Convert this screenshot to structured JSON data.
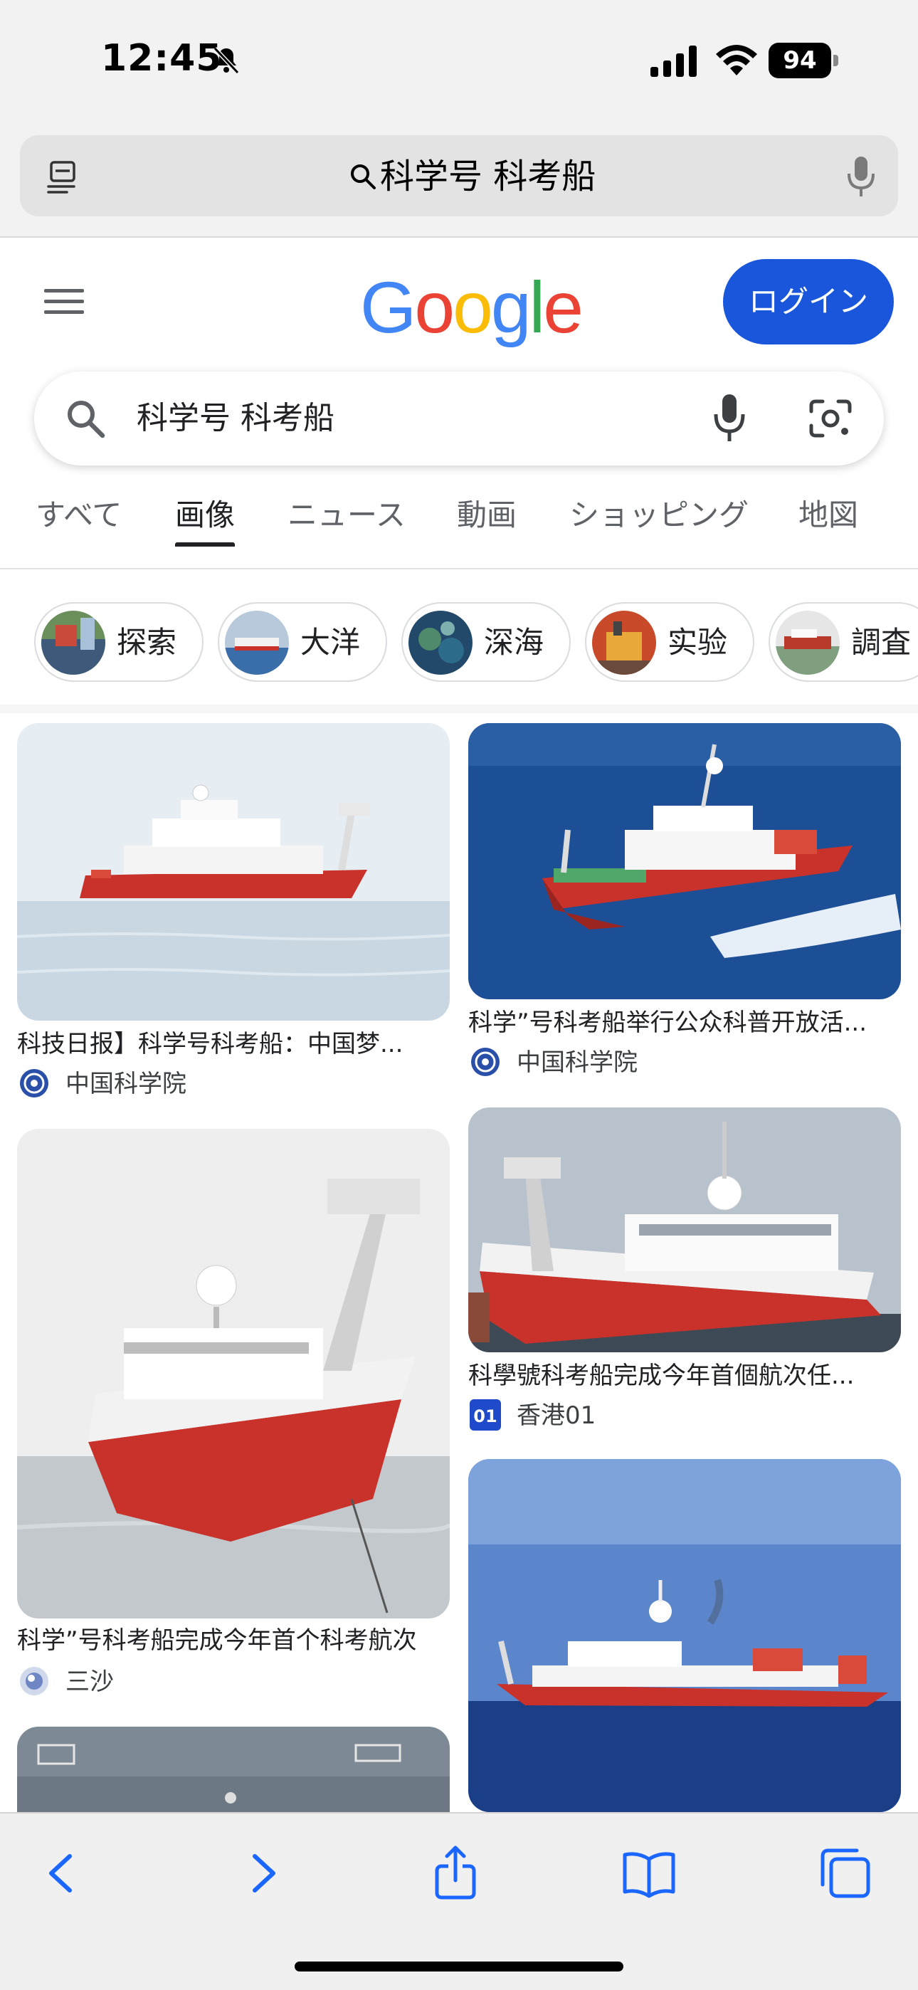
{
  "status_bar": {
    "time": "12:45",
    "battery": "94"
  },
  "address_bar": {
    "query": "科学号 科考船"
  },
  "header": {
    "logo_letters": [
      "G",
      "o",
      "o",
      "g",
      "l",
      "e"
    ],
    "logo_colors": [
      "#4285F4",
      "#EA4335",
      "#FBBC05",
      "#4285F4",
      "#34A853",
      "#EA4335"
    ],
    "login_label": "ログイン"
  },
  "search": {
    "query": "科学号 科考船"
  },
  "tabs": [
    {
      "label": "すべて",
      "active": false
    },
    {
      "label": "画像",
      "active": true
    },
    {
      "label": "ニュース",
      "active": false
    },
    {
      "label": "動画",
      "active": false
    },
    {
      "label": "ショッピング",
      "active": false
    },
    {
      "label": "地図",
      "active": false
    }
  ],
  "chips": [
    {
      "label": "探索"
    },
    {
      "label": "大洋"
    },
    {
      "label": "深海"
    },
    {
      "label": "实验"
    },
    {
      "label": "調査"
    }
  ],
  "results": [
    {
      "title": "科技日报】科学号科考船：中国梦...",
      "source": "中国科学院"
    },
    {
      "title": "科学”号科考船举行公众科普开放活...",
      "source": "中国科学院"
    },
    {
      "title": "科学”号科考船完成今年首个科考航次",
      "source": "三沙"
    },
    {
      "title": "科學號科考船完成今年首個航次任...",
      "source": "香港01"
    }
  ],
  "colors": {
    "accent": "#1a56db",
    "hull_red": "#c8322a"
  }
}
